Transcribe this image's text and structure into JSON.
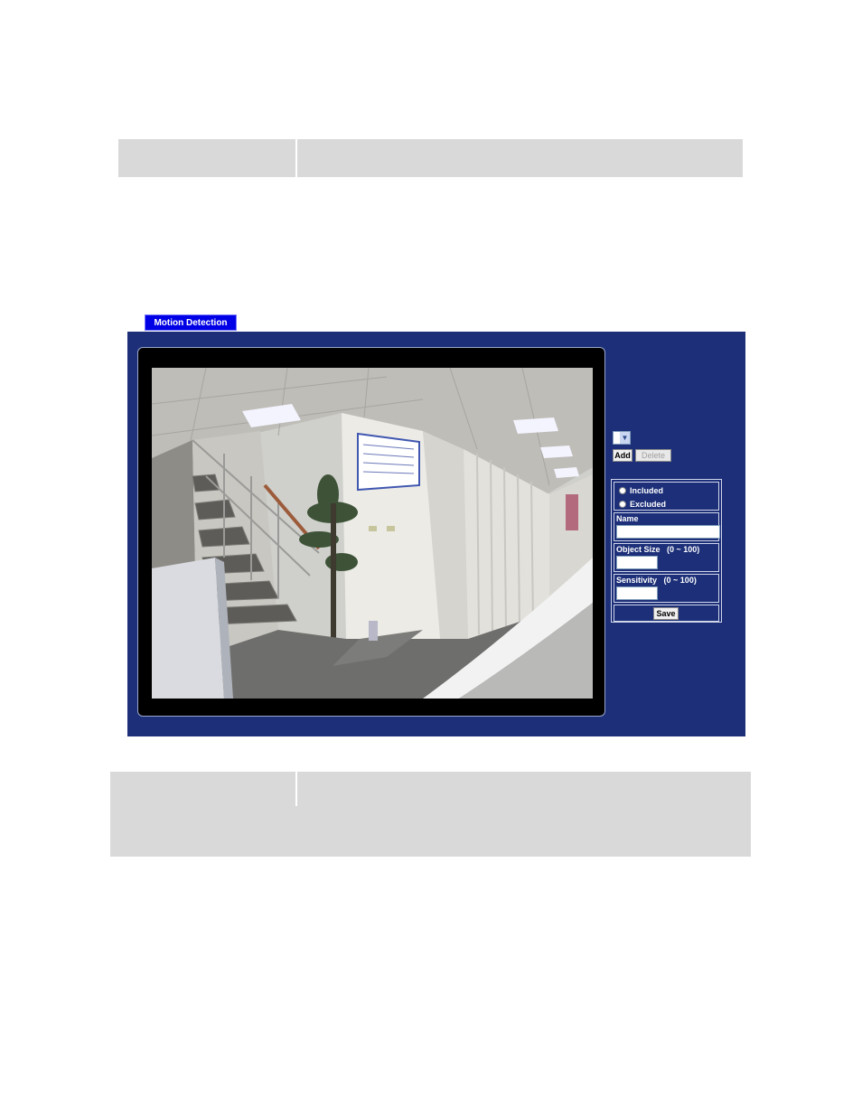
{
  "tab": {
    "label": "Motion Detection"
  },
  "controls": {
    "add_label": "Add",
    "delete_label": "Delete"
  },
  "settings": {
    "included_label": "Included",
    "excluded_label": "Excluded",
    "name_label": "Name",
    "name_value": "",
    "object_size_label": "Object Size",
    "object_size_range": "(0 ~ 100)",
    "object_size_value": "",
    "sensitivity_label": "Sensitivity",
    "sensitivity_range": "(0 ~ 100)",
    "sensitivity_value": "",
    "save_label": "Save"
  },
  "colors": {
    "panel": "#1c2f78",
    "tab": "#0000e6",
    "gray_rows": "#d9d9d9"
  }
}
